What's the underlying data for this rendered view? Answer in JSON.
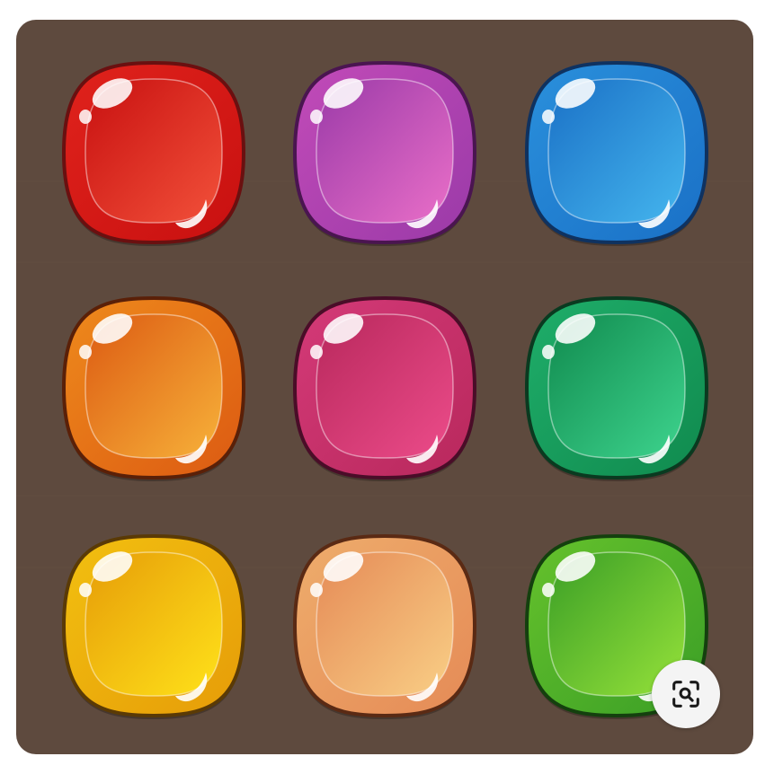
{
  "board": {
    "background_color": "#5e4a3e",
    "rows": 3,
    "cols": 3
  },
  "gems": [
    {
      "id": "red",
      "row": 0,
      "col": 0,
      "light": "#f2513a",
      "dark": "#c81010",
      "rim": "#e0231c",
      "outline": "#6a1010"
    },
    {
      "id": "purple",
      "row": 0,
      "col": 1,
      "light": "#ea6fc8",
      "dark": "#9a3aa8",
      "rim": "#c24bb8",
      "outline": "#4a1550"
    },
    {
      "id": "blue",
      "row": 0,
      "col": 2,
      "light": "#45b6ee",
      "dark": "#1a70c6",
      "rim": "#2a90dc",
      "outline": "#0f3260"
    },
    {
      "id": "orange",
      "row": 1,
      "col": 0,
      "light": "#f7b23a",
      "dark": "#dc5a12",
      "rim": "#ee8a1c",
      "outline": "#5a2008"
    },
    {
      "id": "magenta",
      "row": 1,
      "col": 1,
      "light": "#ec4c8a",
      "dark": "#b8285c",
      "rim": "#d43a78",
      "outline": "#4a0d28"
    },
    {
      "id": "green",
      "row": 1,
      "col": 2,
      "light": "#3ed48e",
      "dark": "#108a4e",
      "rim": "#1fae6a",
      "outline": "#0a3a20"
    },
    {
      "id": "yellow",
      "row": 2,
      "col": 0,
      "light": "#ffe21a",
      "dark": "#e69c08",
      "rim": "#f2c010",
      "outline": "#5a3a06"
    },
    {
      "id": "peach",
      "row": 2,
      "col": 1,
      "light": "#f9cf86",
      "dark": "#e58a56",
      "rim": "#eead6c",
      "outline": "#5a2a14"
    },
    {
      "id": "lime",
      "row": 2,
      "col": 2,
      "light": "#96e23a",
      "dark": "#3a9e26",
      "rim": "#66c22c",
      "outline": "#14400e"
    }
  ],
  "visual_search_button": {
    "icon": "lens-search-icon",
    "color": "#1a1a1a"
  }
}
